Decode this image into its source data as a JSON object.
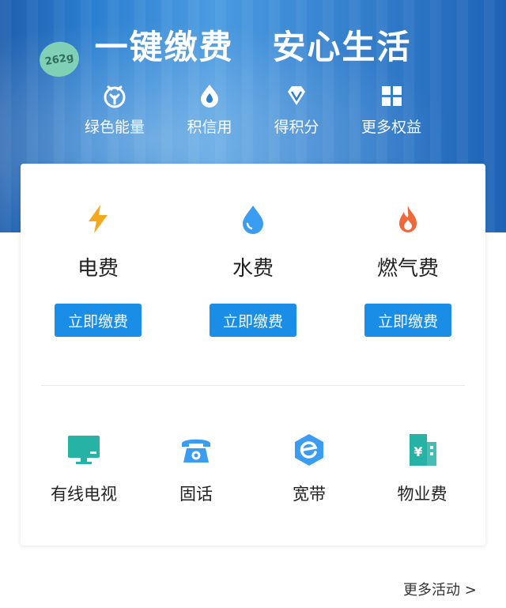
{
  "banner": {
    "badge": "262g",
    "headline_left": "一键缴费",
    "headline_right": "安心生活",
    "benefits": [
      {
        "label": "绿色能量",
        "icon": "leaf-icon"
      },
      {
        "label": "积信用",
        "icon": "credit-drop-icon"
      },
      {
        "label": "得积分",
        "icon": "diamond-icon"
      },
      {
        "label": "更多权益",
        "icon": "grid-icon"
      }
    ]
  },
  "utilities": [
    {
      "name": "电费",
      "button": "立即缴费",
      "icon": "lightning-icon",
      "color": "#f4a81d"
    },
    {
      "name": "水费",
      "button": "立即缴费",
      "icon": "water-drop-icon",
      "color": "#3a9df2"
    },
    {
      "name": "燃气费",
      "button": "立即缴费",
      "icon": "flame-icon",
      "color": "#f0683a"
    }
  ],
  "services": [
    {
      "name": "有线电视",
      "icon": "tv-icon",
      "color": "#26b3a6"
    },
    {
      "name": "固话",
      "icon": "telephone-icon",
      "color": "#3a9df2"
    },
    {
      "name": "宽带",
      "icon": "broadband-icon",
      "color": "#3a9df2"
    },
    {
      "name": "物业费",
      "icon": "building-icon",
      "color": "#26b3a6"
    }
  ],
  "footer": {
    "more_activities": "更多活动 >"
  },
  "colors": {
    "primary": "#1a8ee6",
    "banner_blue": "#2b7fd0"
  }
}
